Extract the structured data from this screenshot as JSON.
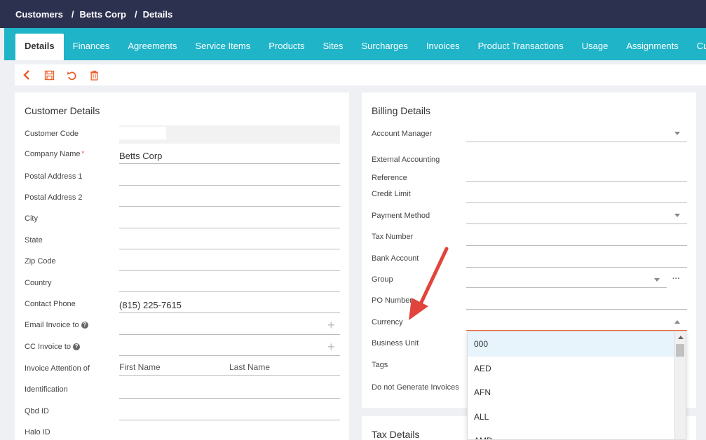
{
  "breadcrumb": {
    "items": [
      "Customers",
      "Betts Corp",
      "Details"
    ],
    "separator": "/"
  },
  "tabs": [
    "Details",
    "Finances",
    "Agreements",
    "Service Items",
    "Products",
    "Sites",
    "Surcharges",
    "Invoices",
    "Product Transactions",
    "Usage",
    "Assignments",
    "Custo"
  ],
  "active_tab": "Details",
  "toolbar": {
    "icons": [
      "back-icon",
      "save-icon",
      "undo-icon",
      "delete-icon"
    ],
    "accent": "#e8602c"
  },
  "customer_details": {
    "title": "Customer Details",
    "labels": {
      "customer_code": "Customer Code",
      "company_name": "Company Name",
      "required_mark": "*",
      "postal_address_1": "Postal Address 1",
      "postal_address_2": "Postal Address 2",
      "city": "City",
      "state": "State",
      "zip_code": "Zip Code",
      "country": "Country",
      "contact_phone": "Contact Phone",
      "email_invoice_to": "Email Invoice to",
      "cc_invoice_to": "CC Invoice to",
      "invoice_attention_of": "Invoice Attention of",
      "identification": "Identification",
      "qbd_id": "Qbd ID",
      "halo_id": "Halo ID"
    },
    "values": {
      "company_name": "Betts Corp",
      "contact_phone": "(815) 225-7615",
      "first_name_placeholder": "First Name",
      "last_name_placeholder": "Last Name"
    }
  },
  "billing_details": {
    "title": "Billing Details",
    "labels": {
      "account_manager": "Account Manager",
      "external_accounting_1": "External Accounting",
      "external_accounting_2": "Reference",
      "credit_limit": "Credit Limit",
      "payment_method": "Payment Method",
      "tax_number": "Tax Number",
      "bank_account": "Bank Account",
      "group": "Group",
      "po_number": "PO Number",
      "currency": "Currency",
      "business_unit": "Business Unit",
      "tags": "Tags",
      "do_not_generate": "Do not Generate Invoices"
    },
    "group_more": "···"
  },
  "currency_dropdown": {
    "options": [
      "000",
      "AED",
      "AFN",
      "ALL",
      "AMD"
    ],
    "highlighted": "000"
  },
  "tax_details": {
    "title": "Tax Details"
  },
  "colors": {
    "topbar": "#2d3150",
    "tabbar": "#1fb4c8",
    "annotation_arrow": "#e0443a"
  }
}
